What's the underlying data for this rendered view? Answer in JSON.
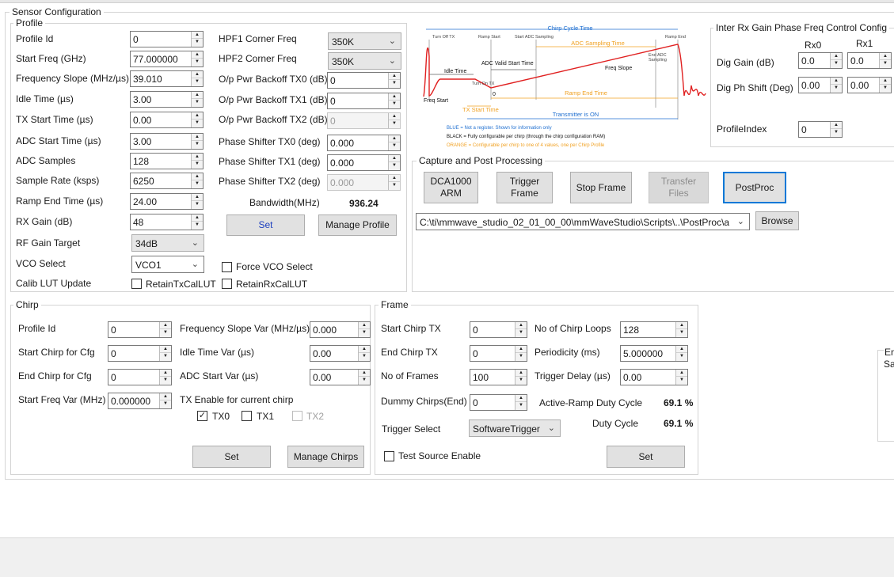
{
  "window": {
    "title": "Sensor Configuration"
  },
  "profile": {
    "title": "Profile",
    "fields": [
      {
        "label": "Profile Id",
        "value": "0"
      },
      {
        "label": "Start Freq (GHz)",
        "value": "77.000000"
      },
      {
        "label": "Frequency Slope (MHz/µs)",
        "value": "39.010"
      },
      {
        "label": "Idle Time (µs)",
        "value": "3.00"
      },
      {
        "label": "TX Start Time (µs)",
        "value": "0.00"
      },
      {
        "label": "ADC Start Time (µs)",
        "value": "3.00"
      },
      {
        "label": "ADC Samples",
        "value": "128"
      },
      {
        "label": "Sample Rate (ksps)",
        "value": "6250"
      },
      {
        "label": "Ramp End Time (µs)",
        "value": "24.00"
      },
      {
        "label": "RX Gain (dB)",
        "value": "48"
      }
    ],
    "rf_gain_target": {
      "label": "RF Gain Target",
      "value": "34dB"
    },
    "vco_select": {
      "label": "VCO Select",
      "value": "VCO1"
    },
    "calib_lut": {
      "label": "Calib LUT Update"
    },
    "hpf1": {
      "label": "HPF1 Corner Freq",
      "value": "350K"
    },
    "hpf2": {
      "label": "HPF2 Corner Freq",
      "value": "350K"
    },
    "right_fields": [
      {
        "label": "O/p Pwr Backoff TX0 (dB)",
        "value": "0"
      },
      {
        "label": "O/p Pwr Backoff TX1 (dB)",
        "value": "0"
      },
      {
        "label": "O/p Pwr Backoff TX2 (dB)",
        "value": "0"
      },
      {
        "label": "Phase Shifter TX0 (deg)",
        "value": "0.000"
      },
      {
        "label": "Phase Shifter TX1 (deg)",
        "value": "0.000"
      },
      {
        "label": "Phase Shifter TX2 (deg)",
        "value": "0.000"
      }
    ],
    "bandwidth_label": "Bandwidth(MHz)",
    "bandwidth_value": "936.24",
    "set_label": "Set",
    "manage_label": "Manage Profile",
    "force_vco": "Force VCO Select",
    "retain_tx": "RetainTxCalLUT",
    "retain_rx": "RetainRxCalLUT"
  },
  "diagram": {
    "chirp_cycle_time": "Chirp Cycle Time",
    "turn_off_tx": "Turn Off TX",
    "ramp_start": "Ramp Start",
    "start_adc_sampling": "Start ADC Sampling",
    "ramp_end": "Ramp End",
    "adc_sampling_time": "ADC Sampling Time",
    "end_adc": "End ADC",
    "sampling": "Sampling",
    "adc_valid_start_time": "ADC Valid Start Time",
    "idle_time": "Idle Time",
    "freq_slope": "Freq Slope",
    "turn_on_tx": "Turn On TX",
    "freq_start": "Freq Start",
    "zero": "0",
    "ramp_end_time": "Ramp End Time",
    "tx_start_time": "TX Start Time",
    "transmitter_on": "Transmitter is ON",
    "legend_blue": "BLUE = Not a register. Shown for information only",
    "legend_black": "BLACK = Fully configurable per chirp (through the chirp configuration RAM)",
    "legend_orange": "ORANGE = Configurable per chirp to one of 4 values, one per Chirp Profile",
    "colors": {
      "blue": "#1f6fd0",
      "orange": "#f0a020",
      "red": "#e02020"
    }
  },
  "inter_rx": {
    "title": "Inter Rx Gain Phase Freq Control Config",
    "rx0": "Rx0",
    "rx1": "Rx1",
    "dig_gain": "Dig Gain (dB)",
    "dig_gain_rx0": "0.0",
    "dig_gain_rx1": "0.0",
    "dig_ph": "Dig Ph Shift (Deg)",
    "dig_ph_rx0": "0.00",
    "dig_ph_rx1": "0.00",
    "profile_index": "ProfileIndex",
    "profile_index_value": "0"
  },
  "capture": {
    "title": "Capture and Post Processing",
    "dca": "DCA1000 ARM",
    "trigger": "Trigger Frame",
    "stop": "Stop Frame",
    "transfer": "Transfer Files",
    "postproc": "PostProc",
    "path": "C:\\ti\\mmwave_studio_02_01_00_00\\mmWaveStudio\\Scripts\\..\\PostProc\\a",
    "browse": "Browse"
  },
  "chirp": {
    "title": "Chirp",
    "fields": [
      {
        "label": "Profile Id",
        "value": "0"
      },
      {
        "label": "Start Chirp for Cfg",
        "value": "0"
      },
      {
        "label": "End Chirp for Cfg",
        "value": "0"
      },
      {
        "label": "Start Freq Var (MHz)",
        "value": "0.000000"
      }
    ],
    "right_fields": [
      {
        "label": "Frequency Slope Var (MHz/µs)",
        "value": "0.000"
      },
      {
        "label": "Idle Time Var (µs)",
        "value": "0.00"
      },
      {
        "label": "ADC Start Var (µs)",
        "value": "0.00"
      }
    ],
    "tx_enable": "TX Enable for current chirp",
    "tx0": "TX0",
    "tx1": "TX1",
    "tx2": "TX2",
    "set": "Set",
    "manage": "Manage Chirps"
  },
  "frame": {
    "title": "Frame",
    "fields": [
      {
        "label": "Start Chirp TX",
        "value": "0"
      },
      {
        "label": "End Chirp TX",
        "value": "0"
      },
      {
        "label": "No of Frames",
        "value": "100"
      },
      {
        "label": "Dummy Chirps(End)",
        "value": "0"
      }
    ],
    "right_fields": [
      {
        "label": "No of Chirp Loops",
        "value": "128"
      },
      {
        "label": "Periodicity (ms)",
        "value": "5.000000"
      },
      {
        "label": "Trigger Delay (µs)",
        "value": "0.00"
      }
    ],
    "active_duty_label": "Active-Ramp Duty Cycle",
    "active_duty_value": "69.1 %",
    "duty_label": "Duty Cycle",
    "duty_value": "69.1 %",
    "trigger_select_label": "Trigger Select",
    "trigger_select_value": "SoftwareTrigger",
    "test_source": "Test Source Enable",
    "set": "Set"
  },
  "partial": {
    "en": "En",
    "sa": "Sa"
  }
}
